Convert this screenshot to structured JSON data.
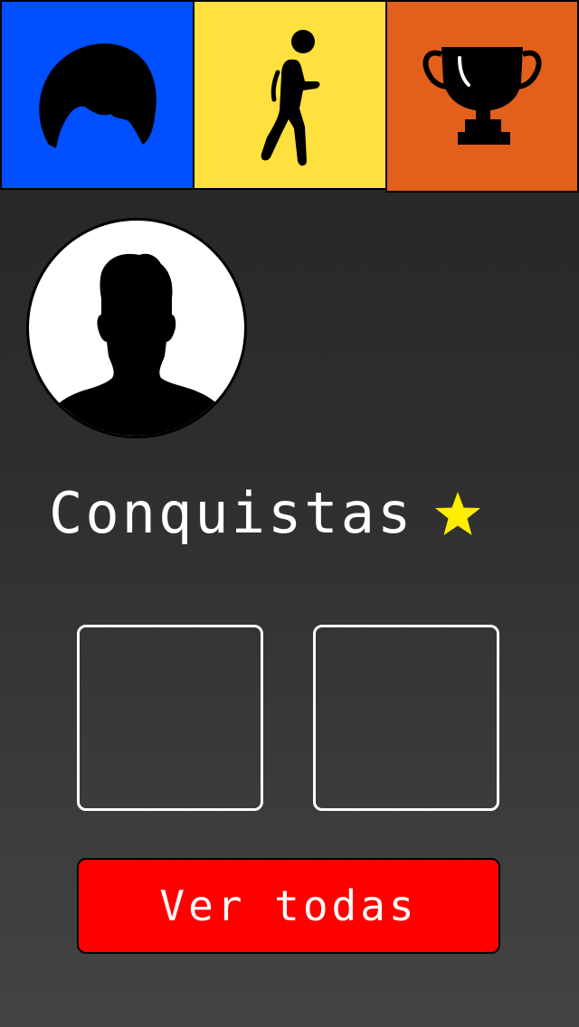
{
  "tabs": [
    {
      "icon": "hair-icon",
      "color": "#0050ff"
    },
    {
      "icon": "walking-person-icon",
      "color": "#fee03e"
    },
    {
      "icon": "trophy-icon",
      "color": "#e2601c"
    }
  ],
  "profile": {
    "avatar_icon": "user-silhouette-icon"
  },
  "achievements": {
    "title": "Conquistas",
    "star_icon": "star-icon",
    "star_color": "#ffee00",
    "slots": 2
  },
  "actions": {
    "view_all_label": "Ver todas",
    "view_all_color": "#ff0000"
  }
}
